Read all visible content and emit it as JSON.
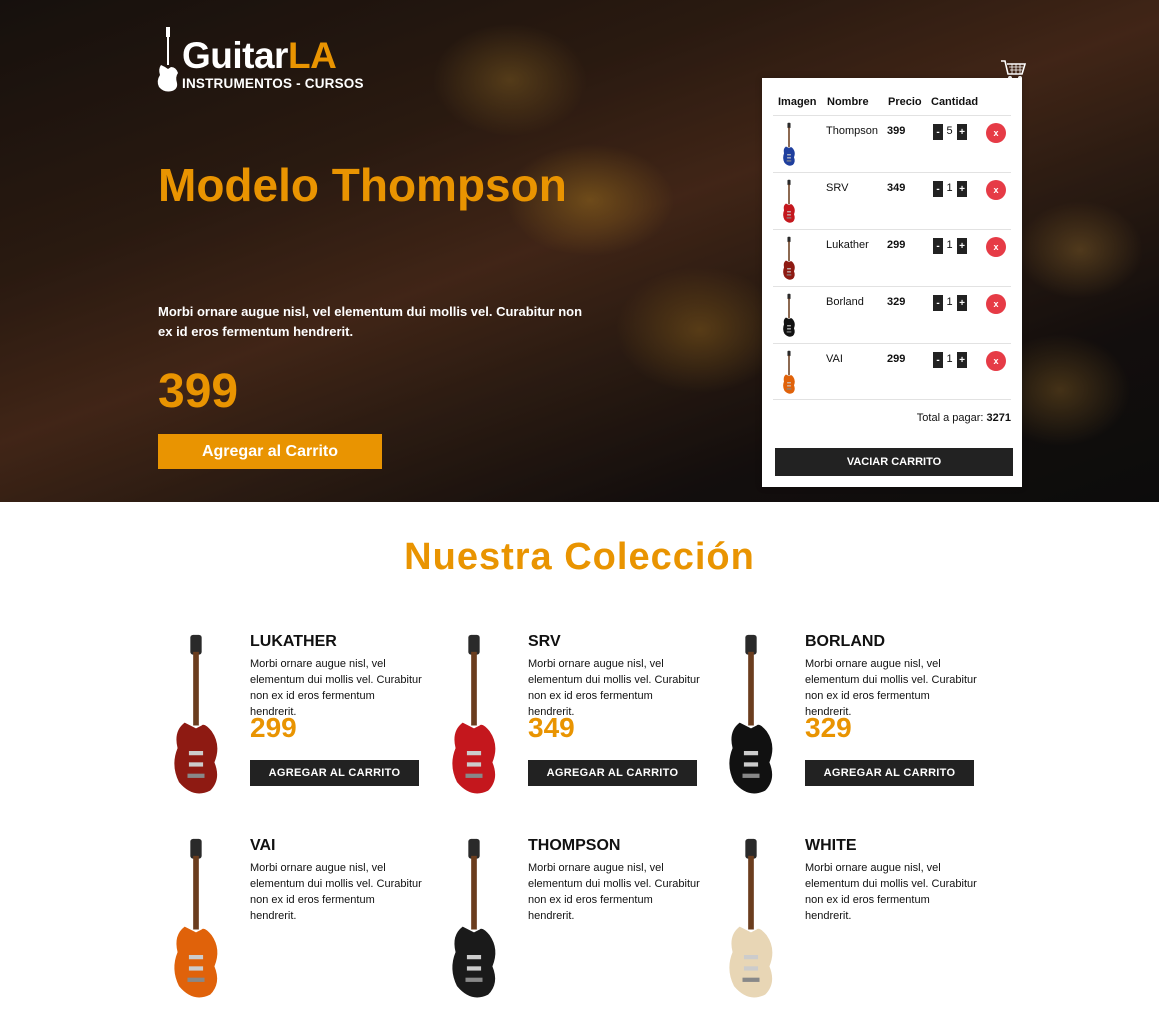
{
  "colors": {
    "accent": "#e99401",
    "dark": "#222222",
    "delete": "#e63b46"
  },
  "logo": {
    "word1": "Guitar",
    "word2": "LA",
    "tagline": "INSTRUMENTOS - CURSOS"
  },
  "hero": {
    "title": "Modelo Thompson",
    "description": "Morbi ornare augue nisl, vel elementum dui mollis vel. Curabitur non ex id eros fermentum hendrerit.",
    "price": "399",
    "button": "Agregar al Carrito"
  },
  "cart": {
    "icon": "cart-icon",
    "headers": {
      "image": "Imagen",
      "name": "Nombre",
      "price": "Precio",
      "quantity": "Cantidad"
    },
    "items": [
      {
        "name": "Thompson",
        "price": "399",
        "qty": "5",
        "guitar_color": "#1f3f9e"
      },
      {
        "name": "SRV",
        "price": "349",
        "qty": "1",
        "guitar_color": "#c4171d"
      },
      {
        "name": "Lukather",
        "price": "299",
        "qty": "1",
        "guitar_color": "#8e1a12"
      },
      {
        "name": "Borland",
        "price": "329",
        "qty": "1",
        "guitar_color": "#111111"
      },
      {
        "name": "VAI",
        "price": "299",
        "qty": "1",
        "guitar_color": "#e0620a"
      }
    ],
    "minus": "-",
    "plus": "+",
    "delete": "x",
    "total_label": "Total a pagar:",
    "total_value": "3271",
    "empty_button": "VACIAR CARRITO"
  },
  "collection": {
    "title": "Nuestra Colección",
    "products": [
      {
        "name": "LUKATHER",
        "description": "Morbi ornare augue nisl, vel elementum dui mollis vel. Curabitur non ex id eros fermentum hendrerit.",
        "price": "299",
        "button": "AGREGAR AL CARRITO",
        "guitar_color": "#8e1a12"
      },
      {
        "name": "SRV",
        "description": "Morbi ornare augue nisl, vel elementum dui mollis vel. Curabitur non ex id eros fermentum hendrerit.",
        "price": "349",
        "button": "AGREGAR AL CARRITO",
        "guitar_color": "#c4171d"
      },
      {
        "name": "BORLAND",
        "description": "Morbi ornare augue nisl, vel elementum dui mollis vel. Curabitur non ex id eros fermentum hendrerit.",
        "price": "329",
        "button": "AGREGAR AL CARRITO",
        "guitar_color": "#111111"
      },
      {
        "name": "VAI",
        "description": "Morbi ornare augue nisl, vel elementum dui mollis vel. Curabitur non ex id eros fermentum hendrerit.",
        "price": "",
        "button": "",
        "guitar_color": "#e0620a"
      },
      {
        "name": "THOMPSON",
        "description": "Morbi ornare augue nisl, vel elementum dui mollis vel. Curabitur non ex id eros fermentum hendrerit.",
        "price": "",
        "button": "",
        "guitar_color": "#1a1a1a"
      },
      {
        "name": "WHITE",
        "description": "Morbi ornare augue nisl, vel elementum dui mollis vel. Curabitur non ex id eros fermentum hendrerit.",
        "price": "",
        "button": "",
        "guitar_color": "#e8d6b5"
      }
    ]
  }
}
